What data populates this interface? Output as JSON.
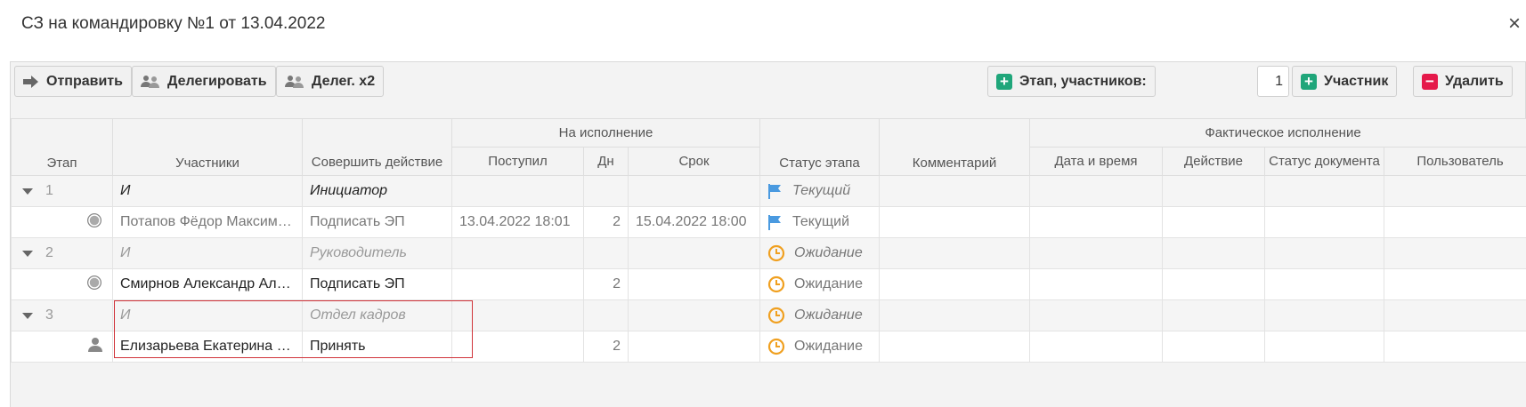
{
  "dialog": {
    "title": "СЗ на командировку №1 от 13.04.2022",
    "close": "×"
  },
  "toolbar": {
    "send": "Отправить",
    "delegate": "Делегировать",
    "delegate2": "Делег. x2",
    "stage_participants": "Этап, участников:",
    "participants_count": "1",
    "add_participant": "Участник",
    "delete": "Удалить"
  },
  "columns": {
    "stage": "Этап",
    "participants": "Участники",
    "action": "Совершить действие",
    "in_work": "На исполнение",
    "received": "Поступил",
    "days": "Дн",
    "deadline": "Срок",
    "stage_status": "Статус этапа",
    "comment": "Комментарий",
    "actual": "Фактическое исполнение",
    "datetime": "Дата и время",
    "act": "Действие",
    "doc_status": "Статус документа",
    "user": "Пользователь"
  },
  "rows": [
    {
      "stage": "1",
      "participant": "И",
      "action": "Инициатор",
      "received": "",
      "days": "",
      "deadline": "",
      "status": "Текущий"
    },
    {
      "participant": "Потапов Фёдор Максимович",
      "action": "Подписать ЭП",
      "received": "13.04.2022 18:01",
      "days": "2",
      "deadline": "15.04.2022 18:00",
      "status": "Текущий"
    },
    {
      "stage": "2",
      "participant": "И",
      "action": "Руководитель",
      "received": "",
      "days": "",
      "deadline": "",
      "status": "Ожидание"
    },
    {
      "participant": "Смирнов Александр Алексеевич",
      "action": "Подписать ЭП",
      "received": "",
      "days": "2",
      "deadline": "",
      "status": "Ожидание"
    },
    {
      "stage": "3",
      "participant": "И",
      "action": "Отдел кадров",
      "received": "",
      "days": "",
      "deadline": "",
      "status": "Ожидание"
    },
    {
      "participant": "Елизарьева Екатерина Андреевна",
      "action": "Принять",
      "received": "",
      "days": "2",
      "deadline": "",
      "status": "Ожидание"
    }
  ],
  "colors": {
    "flag": "#4a9ae0",
    "clock": "#f0a020",
    "highlight": "#d0343a",
    "add": "#1fa67a",
    "delete": "#e5194a"
  }
}
